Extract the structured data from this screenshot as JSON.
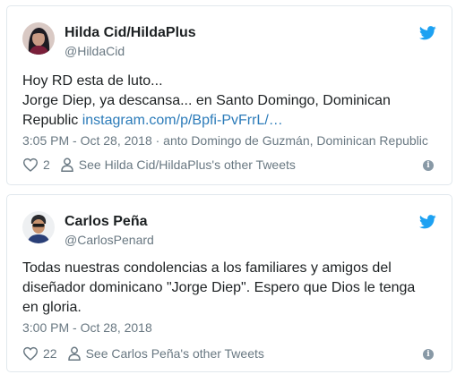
{
  "tweets": [
    {
      "author_name": "Hilda Cid/HildaPlus",
      "author_handle": "@HildaCid",
      "text_lines": [
        "Hoy RD esta de luto...",
        "Jorge Diep, ya descansa... en Santo Domingo, Dominican",
        "Republic "
      ],
      "link": "instagram.com/p/Bpfi-PvFrrL/…",
      "meta": "3:05 PM - Oct 28, 2018 · anto Domingo de Guzmán, Dominican Republic",
      "like_count": "2",
      "profile_link": "See Hilda Cid/HildaPlus's other Tweets"
    },
    {
      "author_name": "Carlos Peña",
      "author_handle": "@CarlosPenard",
      "text_lines": [
        "Todas nuestras condolencias a los familiares y amigos del",
        "diseñador dominicano \"Jorge Diep\". Espero que Dios le tenga",
        "en gloria."
      ],
      "meta": "3:00 PM - Oct 28, 2018",
      "like_count": "22",
      "profile_link": "See Carlos Peña's other Tweets"
    }
  ],
  "icons": {
    "brand": "twitter-bird-icon",
    "like": "heart-icon",
    "profile": "person-icon",
    "info": "info-icon"
  },
  "colors": {
    "twitter_blue": "#1da1f2",
    "link": "#2b7bb9",
    "muted": "#697882",
    "border": "#e1e8ed"
  }
}
